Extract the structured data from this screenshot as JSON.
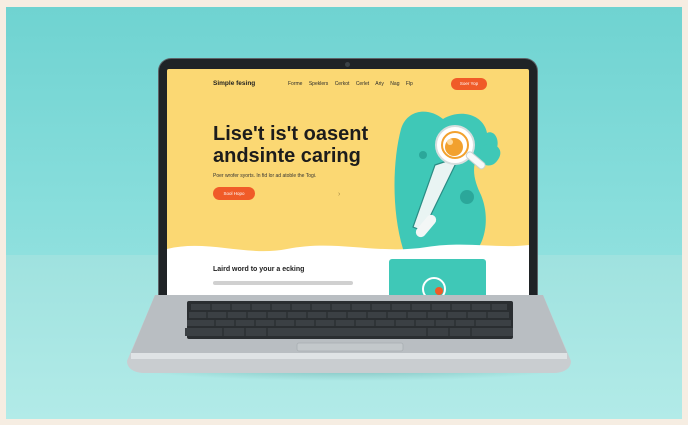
{
  "colors": {
    "scene_bg": "#78d7d5",
    "screen_bg": "#fbd873",
    "accent": "#f05b28",
    "teal": "#3fc8b7"
  },
  "site": {
    "brand": "Simple fesing",
    "nav_links": [
      "Forme",
      "Speklers",
      "Cerkot",
      "Cerlet",
      "Ariy",
      "Nag",
      "Flp"
    ],
    "nav_button": "Soer Yop",
    "hero": {
      "title_line1": "Lise't is't oasent",
      "title_line2": "andsinte caring",
      "subtitle": "Poer wrofer syorts. In fid lor ad atoble the Togi.",
      "button": "Sool Hopo"
    },
    "section_title": "Laird word to your a ecking",
    "illustration_icon": "magnifier-icon"
  }
}
